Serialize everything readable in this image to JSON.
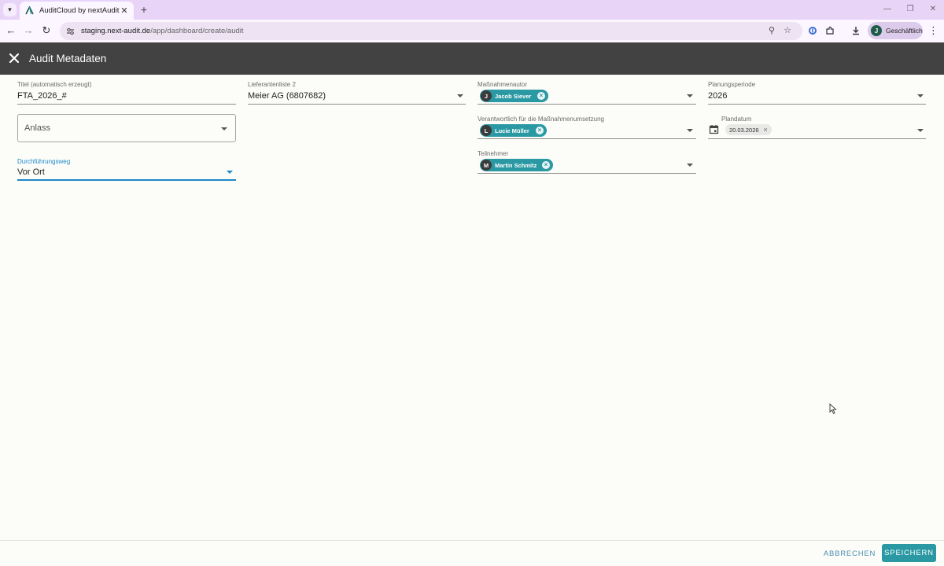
{
  "browser": {
    "tab_title": "AuditCloud by nextAudit",
    "url_host": "staging.next-audit.de",
    "url_path": "/app/dashboard/create/audit",
    "profile_initial": "J",
    "profile_label": "Geschäftlich"
  },
  "header": {
    "title": "Audit Metadaten"
  },
  "form": {
    "titel": {
      "label": "Titel (automatisch erzeugt)",
      "value": "FTA_2026_#"
    },
    "anlass": {
      "placeholder": "Anlass"
    },
    "durchfuehrungsweg": {
      "label": "Durchführungsweg",
      "value": "Vor Ort"
    },
    "lieferantenliste": {
      "label": "Lieferantenliste 2",
      "value": "Meier AG (6807682)"
    },
    "massnahmenautor": {
      "label": "Maßnahmenautor",
      "chip": {
        "initial": "J",
        "name": "Jacob Siever"
      }
    },
    "verantwortlich": {
      "label": "Verantwortlich für die Maßnahmenumsetzung",
      "chip": {
        "initial": "L",
        "name": "Lucie Müller"
      }
    },
    "teilnehmer": {
      "label": "Teilnehmer",
      "chip": {
        "initial": "M",
        "name": "Martin Schmitz"
      }
    },
    "planungsperiode": {
      "label": "Planungsperiode",
      "value": "2026"
    },
    "plandatum": {
      "label": "Plandatum",
      "value": "20.03.2026"
    }
  },
  "footer": {
    "cancel_label": "ABBRECHEN",
    "save_label": "SPEICHERN"
  },
  "colors": {
    "accent": "#2b99a3",
    "header_bg": "#424242",
    "tabstrip_bg": "#e8d4f6",
    "focus_blue": "#1e88c7"
  }
}
